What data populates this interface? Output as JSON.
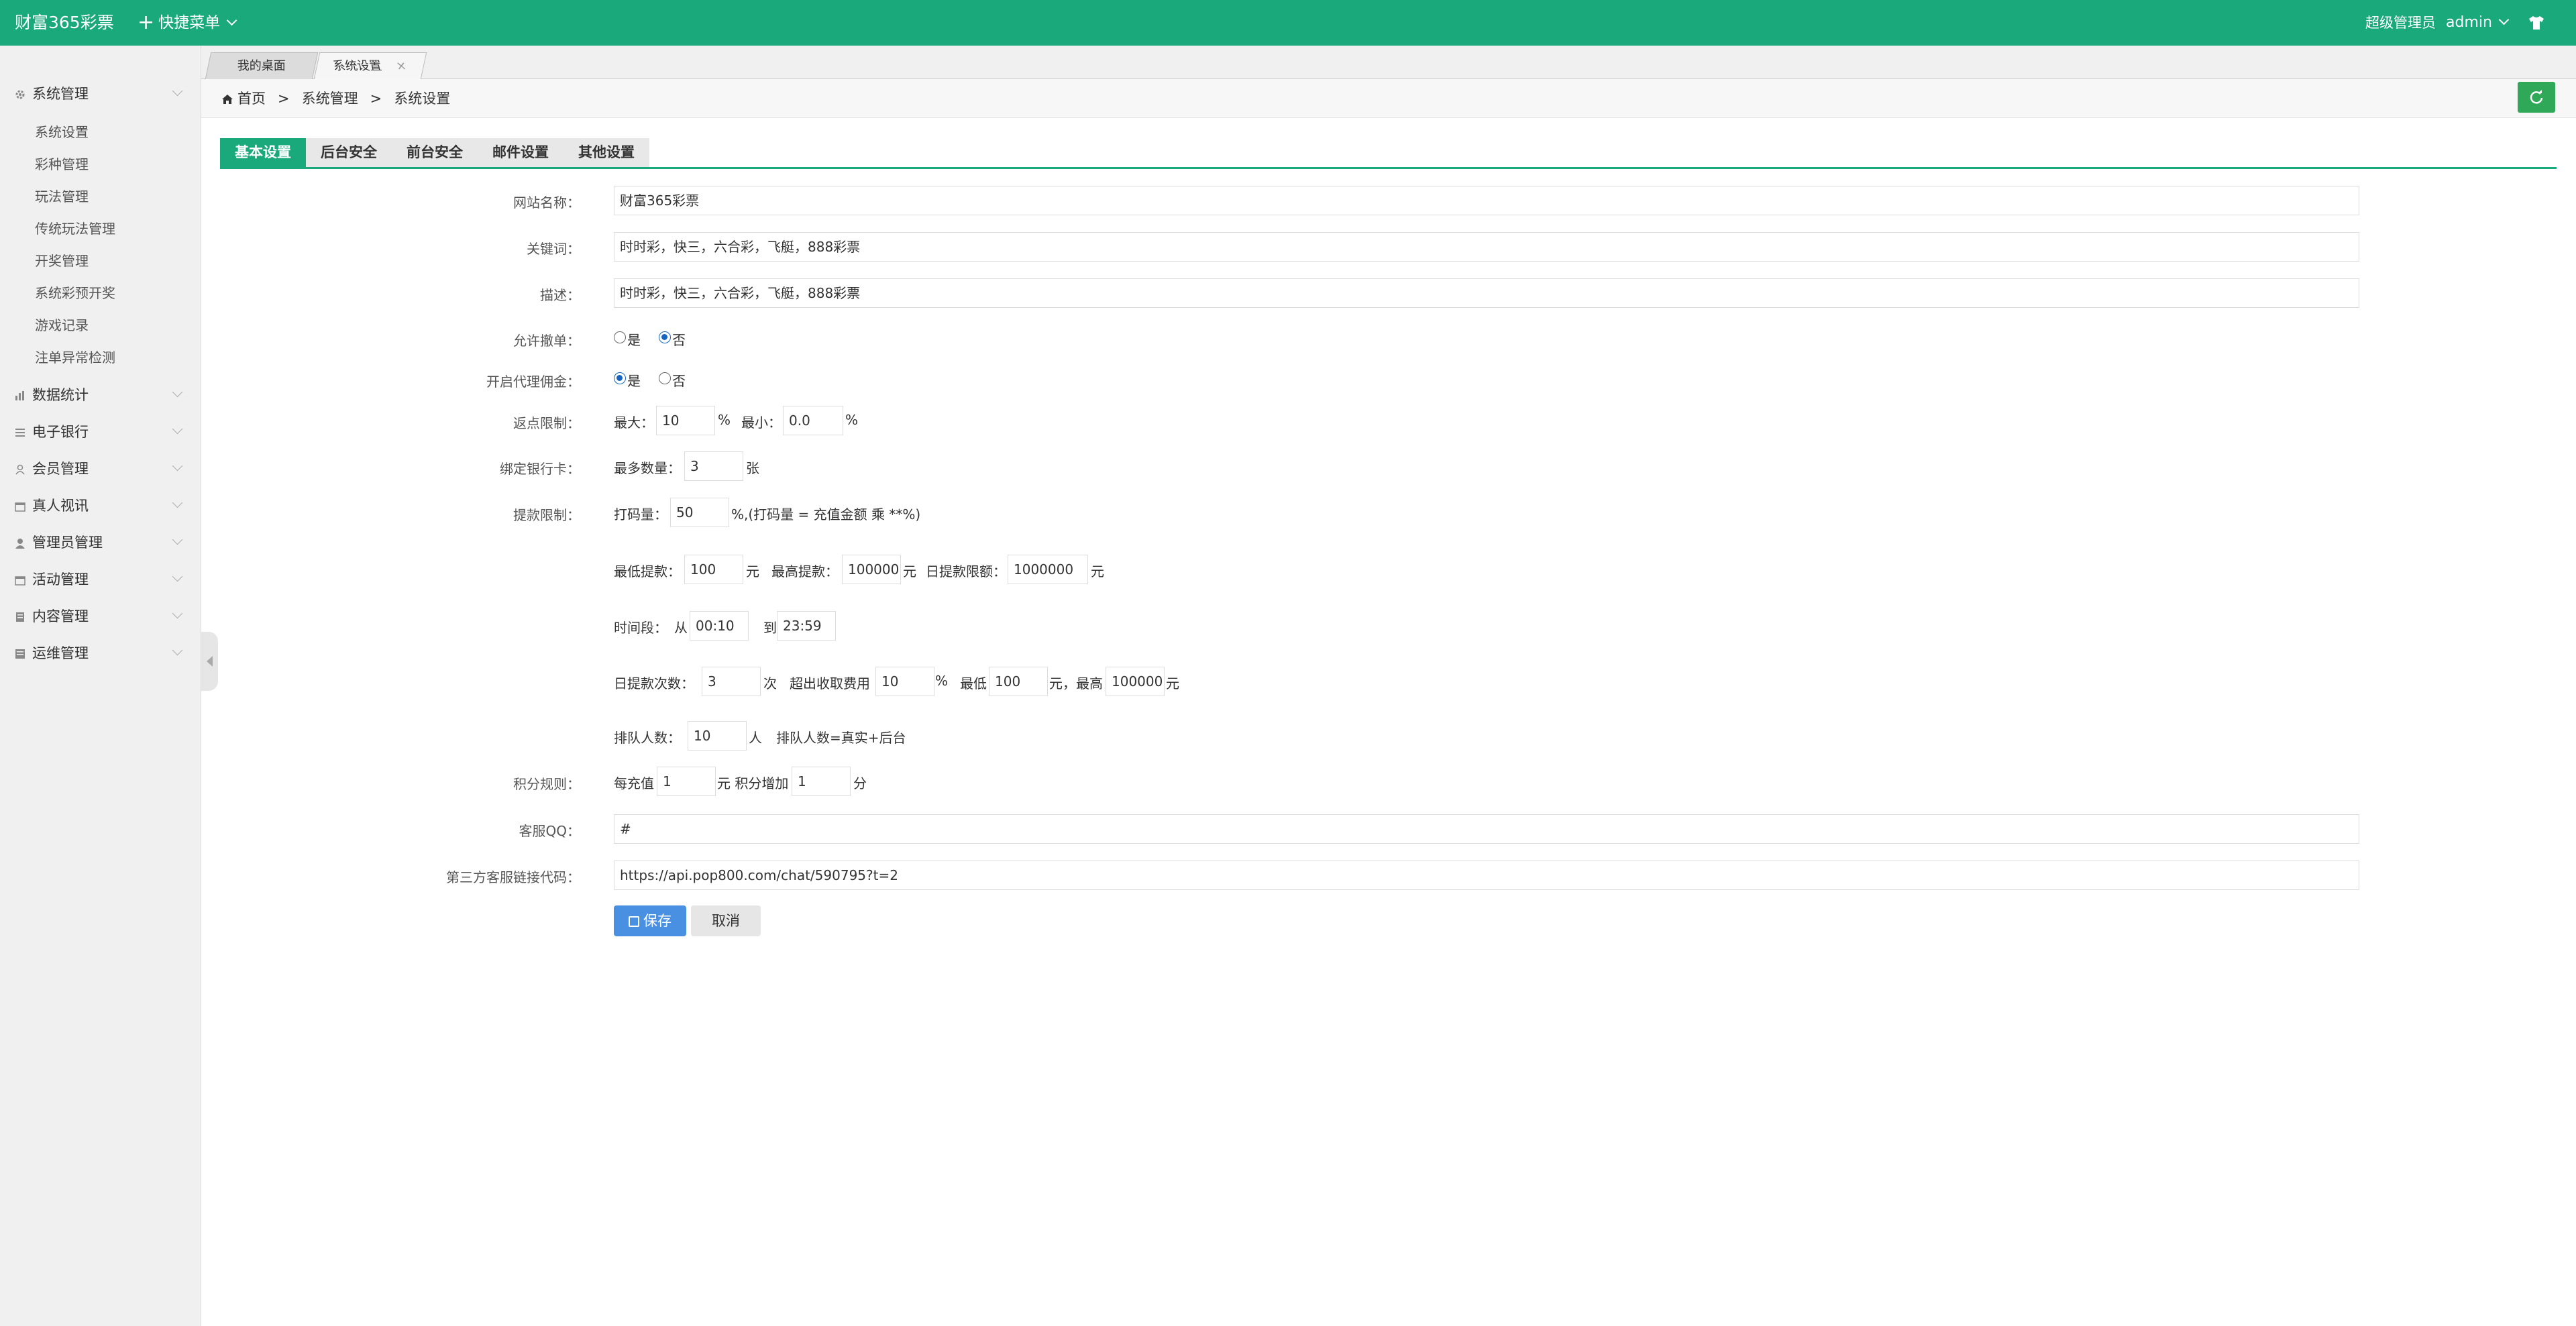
{
  "header": {
    "logo": "财富365彩票",
    "quick_menu": "快捷菜单",
    "role": "超级管理员",
    "user": "admin"
  },
  "sidebar": {
    "sections": [
      {
        "label": "系统管理",
        "icon": "gear-icon"
      },
      {
        "label": "数据统计",
        "icon": "chart-icon"
      },
      {
        "label": "电子银行",
        "icon": "list-icon"
      },
      {
        "label": "会员管理",
        "icon": "user-icon"
      },
      {
        "label": "真人视讯",
        "icon": "calendar-icon"
      },
      {
        "label": "管理员管理",
        "icon": "person-icon"
      },
      {
        "label": "活动管理",
        "icon": "calendar-icon"
      },
      {
        "label": "内容管理",
        "icon": "document-icon"
      },
      {
        "label": "运维管理",
        "icon": "server-icon"
      }
    ],
    "sub_items": [
      "系统设置",
      "彩种管理",
      "玩法管理",
      "传统玩法管理",
      "开奖管理",
      "系统彩预开奖",
      "游戏记录",
      "注单异常检测"
    ]
  },
  "tabs": [
    {
      "label": "我的桌面"
    },
    {
      "label": "系统设置",
      "close": "×"
    }
  ],
  "breadcrumb": [
    "首页",
    "系统管理",
    "系统设置"
  ],
  "breadcrumb_sep": ">",
  "page_tabs": [
    "基本设置",
    "后台安全",
    "前台安全",
    "邮件设置",
    "其他设置"
  ],
  "form": {
    "site_name": {
      "label": "网站名称：",
      "value": "财富365彩票"
    },
    "keywords": {
      "label": "关键词：",
      "value": "时时彩，快三，六合彩，飞艇，888彩票"
    },
    "description": {
      "label": "描述：",
      "value": "时时彩，快三，六合彩，飞艇，888彩票"
    },
    "allow_cancel": {
      "label": "允许撤单：",
      "yes": "是",
      "no": "否",
      "selected": "否"
    },
    "agent_commission": {
      "label": "开启代理佣金：",
      "yes": "是",
      "no": "否",
      "selected": "是"
    },
    "rebate_limit": {
      "label": "返点限制：",
      "max_label": "最大：",
      "max": "10",
      "pct": "%",
      "min_label": "最小：",
      "min": "0.0"
    },
    "bind_card": {
      "label": "绑定银行卡：",
      "max_label": "最多数量：",
      "value": "3",
      "unit": "张"
    },
    "withdraw_limit": {
      "label": "提款限制：",
      "bet_label": "打码量：",
      "bet_value": "50",
      "bet_note": "%,(打码量 = 充值金额 乘 **%)",
      "min_label": "最低提款：",
      "min_value": "100",
      "yuan": "元",
      "max_label": "最高提款：",
      "max_value": "100000",
      "daily_label": "日提款限额：",
      "daily_value": "1000000",
      "time_label": "时间段：",
      "from": "从",
      "from_value": "00:10",
      "to": "到",
      "to_value": "23:59",
      "count_label": "日提款次数：",
      "count_value": "3",
      "times": "次",
      "exceed_label": "超出收取费用",
      "exceed_value": "10",
      "low_label": "最低",
      "low_value": "100",
      "high_label": "元，最高",
      "high_value": "100000",
      "queue_label": "排队人数：",
      "queue_value": "10",
      "people": "人",
      "queue_note": "排队人数=真实+后台"
    },
    "points": {
      "label": "积分规则：",
      "per_label": "每充值",
      "per_value": "1",
      "mid": "元 积分增加",
      "add_value": "1",
      "unit": "分"
    },
    "qq": {
      "label": "客服QQ：",
      "value": "#"
    },
    "third_party": {
      "label": "第三方客服链接代码：",
      "value": "https://api.pop800.com/chat/590795?t=2"
    },
    "save": "保存",
    "cancel": "取消"
  },
  "colors": {
    "brand": "#19a97b",
    "save_button": "#4a90e2",
    "refresh_button": "#2fa957"
  }
}
